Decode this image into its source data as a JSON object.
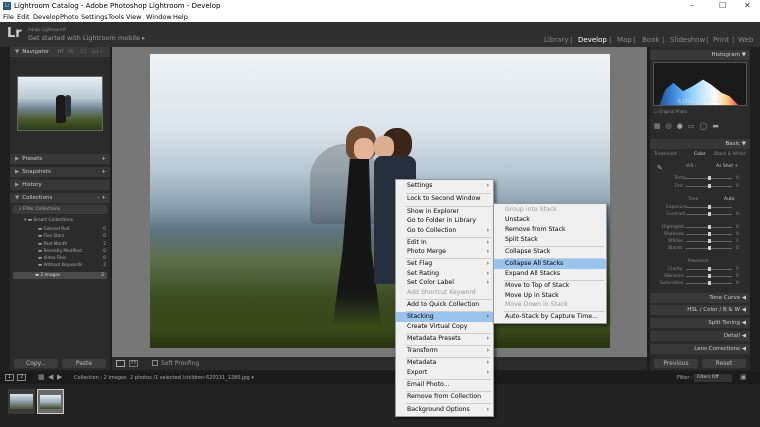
{
  "titlebar": {
    "title": "Lightroom Catalog - Adobe Photoshop Lightroom - Develop",
    "logo": "Lr",
    "minimize": "–",
    "maximize": "☐",
    "close": "✕"
  },
  "menubar": [
    "File",
    "Edit",
    "Develop",
    "Photo",
    "Settings",
    "Tools",
    "View",
    "Window",
    "Help"
  ],
  "identity": {
    "logo": "Lr",
    "sub": "Adobe Lightroom®",
    "text": "Get started with Lightroom mobile ▸",
    "modules": [
      "Library",
      "Develop",
      "Map",
      "Book",
      "Slideshow",
      "Print",
      "Web"
    ],
    "separator": "|",
    "selected": "Develop"
  },
  "left": {
    "navigator": "Navigator",
    "nav_opts": [
      "FIT",
      "Fill",
      "1:1",
      "3:1 ÷"
    ],
    "presets": "Presets",
    "snapshots": "Snapshots",
    "history": "History",
    "collections": "Collections",
    "collections_btns": "– +",
    "filter": "Filter Collections",
    "smart": "Smart Collections",
    "smart_items": [
      {
        "name": "Colored Red",
        "count": "0"
      },
      {
        "name": "Five Stars",
        "count": "0"
      },
      {
        "name": "Past Month",
        "count": "2"
      },
      {
        "name": "Recently Modified",
        "count": "0"
      },
      {
        "name": "Video Files",
        "count": "0"
      },
      {
        "name": "Without Keywords",
        "count": "2"
      }
    ],
    "images": {
      "name": "2 Images",
      "count": "2"
    },
    "copy": "Copy...",
    "paste": "Paste",
    "plus": "+"
  },
  "right": {
    "histogram": "Histogram",
    "hist_values": "R 27.9  G 26.9  B 19.1 %",
    "original": "Original Photo",
    "basic": "Basic",
    "treatment_label": "Treatment :",
    "color": "Color",
    "bw": "Black & White",
    "wb_label": "WB :",
    "wb_value": "As Shot ÷",
    "temp": "Temp",
    "tint": "Tint",
    "tone": "Tone",
    "auto": "Auto",
    "exposure": "Exposure",
    "contrast": "Contrast",
    "highlights": "Highlights",
    "shadows": "Shadows",
    "whites": "Whites",
    "blacks": "Blacks",
    "presence": "Presence",
    "clarity": "Clarity",
    "vibrance": "Vibrance",
    "saturation": "Saturation",
    "zero": "0",
    "tone_curve": "Tone Curve",
    "hsl": "HSL  /  Color  /  B & W",
    "split_toning": "Split Toning",
    "detail": "Detail",
    "lens": "Lens Corrections",
    "previous": "Previous",
    "reset": "Reset"
  },
  "toolbar": {
    "soft_proofing": "Soft Proofing"
  },
  "filmbar": {
    "page1": "1",
    "page2": "2",
    "collection": "Collection : 2 Images",
    "info": "2 photos /1 selected /children-620131_1280.jpg ▾",
    "filter": "Filter :",
    "filter_value": "Filters Off"
  },
  "context_menu": {
    "items": [
      {
        "label": "Settings",
        "arrow": true
      },
      {
        "label": "Lock to Second Window",
        "sep": true
      },
      {
        "label": "Show in Explorer",
        "sep": true
      },
      {
        "label": "Go to Folder in Library"
      },
      {
        "label": "Go to Collection",
        "arrow": true
      },
      {
        "label": "Edit In",
        "arrow": true,
        "sep": true
      },
      {
        "label": "Photo Merge",
        "arrow": true
      },
      {
        "label": "Set Flag",
        "arrow": true,
        "sep": true
      },
      {
        "label": "Set Rating",
        "arrow": true
      },
      {
        "label": "Set Color Label",
        "arrow": true
      },
      {
        "label": "Add Shortcut Keyword",
        "disabled": true
      },
      {
        "label": "Add to Quick Collection",
        "sep": true
      },
      {
        "label": "Stacking",
        "arrow": true,
        "highlight": true,
        "sep": true
      },
      {
        "label": "Create Virtual Copy"
      },
      {
        "label": "Metadata Presets",
        "arrow": true,
        "sep": true
      },
      {
        "label": "Transform",
        "arrow": true,
        "sep": true
      },
      {
        "label": "Metadata",
        "arrow": true,
        "sep": true
      },
      {
        "label": "Export",
        "arrow": true
      },
      {
        "label": "Email Photo...",
        "sep": true
      },
      {
        "label": "Remove from Collection",
        "sep": true
      },
      {
        "label": "Background Options",
        "arrow": true,
        "sep": true
      }
    ]
  },
  "submenu": {
    "items": [
      {
        "label": "Group into Stack",
        "disabled": true
      },
      {
        "label": "Unstack"
      },
      {
        "label": "Remove from Stack"
      },
      {
        "label": "Split Stack"
      },
      {
        "label": "Collapse Stack",
        "sep": true
      },
      {
        "label": "Collapse All Stacks",
        "highlight": true,
        "sep": true
      },
      {
        "label": "Expand All Stacks"
      },
      {
        "label": "Move to Top of Stack",
        "sep": true
      },
      {
        "label": "Move Up in Stack"
      },
      {
        "label": "Move Down in Stack",
        "disabled": true
      },
      {
        "label": "Auto-Stack by Capture Time...",
        "sep": true
      }
    ]
  }
}
